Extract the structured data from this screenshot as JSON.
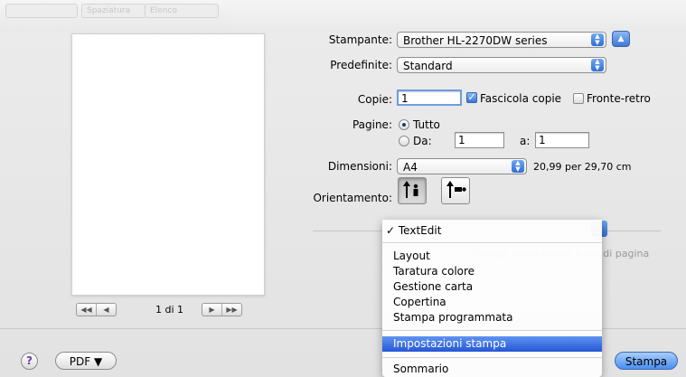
{
  "toolbar": {
    "ghost1": "Spaziatura",
    "ghost2": "Elenco"
  },
  "preview": {
    "page_indicator": "1 di 1"
  },
  "printer": {
    "label": "Stampante:",
    "value": "Brother HL-2270DW series"
  },
  "presets": {
    "label": "Predefinite:",
    "value": "Standard"
  },
  "copies": {
    "label": "Copie:",
    "value": "1",
    "collate_label": "Fascicola copie",
    "collate_checked": true,
    "duplex_label": "Fronte-retro",
    "duplex_checked": false
  },
  "pages": {
    "label": "Pagine:",
    "all_label": "Tutto",
    "from_label": "Da:",
    "from_value": "1",
    "to_label": "a:",
    "to_value": "1"
  },
  "paper": {
    "label": "Dimensioni:",
    "value": "A4",
    "size_text": "20,99 per 29,70 cm"
  },
  "orientation": {
    "label": "Orientamento:"
  },
  "behind_menu": {
    "header_footer_hint": "Stampa intestazione e piè di pagina"
  },
  "menu": {
    "checked_item": "TextEdit",
    "items": [
      "Layout",
      "Taratura colore",
      "Gestione carta",
      "Copertina",
      "Stampa programmata"
    ],
    "highlighted_item": "Impostazioni stampa",
    "last_item": "Sommario"
  },
  "footer": {
    "help": "?",
    "pdf_label": "PDF ▼",
    "print_label": "Stampa"
  },
  "colors": {
    "accent": "#2657d6",
    "background": "#e8e8e8"
  }
}
